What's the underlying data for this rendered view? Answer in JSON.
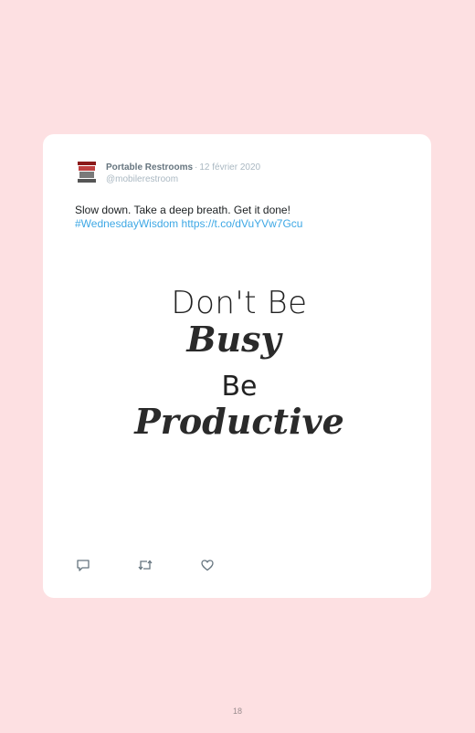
{
  "tweet": {
    "author": "Portable Restrooms",
    "separator": "·",
    "date": "12 février 2020",
    "handle": "@mobilerestroom",
    "text": "Slow down. Take a deep breath. Get it done!",
    "hashtag": "#WednesdayWisdom",
    "link": "https://t.co/dVuYVw7Gcu"
  },
  "media": {
    "line1": "Don't Be",
    "line2": "Busy",
    "line3": "Be",
    "line4": "Productive"
  },
  "actions": [
    "reply-icon",
    "retweet-icon",
    "like-icon"
  ],
  "colors": {
    "page_background": "#fde0e2",
    "card": "#ffffff",
    "link": "#3ea8e5",
    "muted": "#aab8c2"
  },
  "page_number": "18"
}
